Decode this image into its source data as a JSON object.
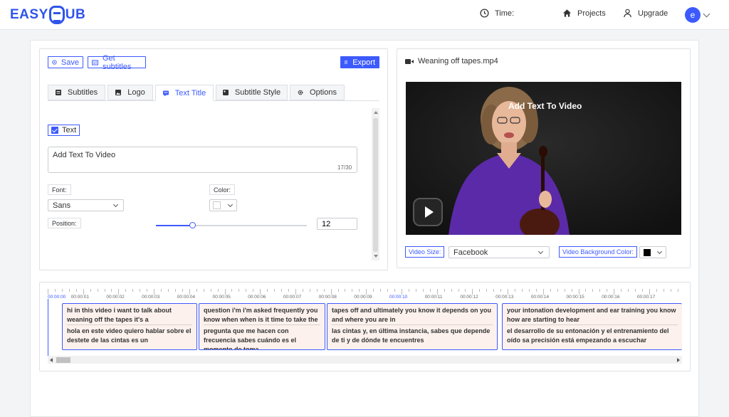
{
  "app": {
    "logo_prefix": "EASY",
    "logo_suffix": "UB"
  },
  "topnav": {
    "time_label": "Time:",
    "projects_label": "Projects",
    "upgrade_label": "Upgrade",
    "avatar_initial": "e"
  },
  "toolbar": {
    "save_label": "Save",
    "get_subtitles_label": "Get subtitles",
    "export_label": "Export"
  },
  "tabs": [
    {
      "label": "Subtitles",
      "icon": "subtitles-icon"
    },
    {
      "label": "Logo",
      "icon": "image-icon"
    },
    {
      "label": "Text Title",
      "icon": "text-title-icon"
    },
    {
      "label": "Subtitle Style",
      "icon": "style-icon"
    },
    {
      "label": "Options",
      "icon": "gear-icon"
    }
  ],
  "active_tab": "Text Title",
  "text_panel": {
    "checkbox_label": "Text",
    "checked": true,
    "text_value": "Add Text To Video",
    "char_counter": "17/30",
    "font_label": "Font:",
    "font_value": "Sans",
    "color_label": "Color:",
    "color_value": "#ffffff",
    "position_label": "Position:",
    "position_fraction": 0.24,
    "size_value": "12"
  },
  "video": {
    "file_name": "Weaning off tapes.mp4",
    "overlay_text": "Add Text To Video",
    "video_size_label": "Video Size:",
    "video_size_value": "Facebook",
    "bg_color_label": "Video Background Color:",
    "bg_color_value": "#000000"
  },
  "timeline": {
    "ticks": [
      "00:00:00",
      "00:00:01",
      "00:00:02",
      "00:00:03",
      "00:00:04",
      "00:00:05",
      "00:00:06",
      "00:00:07",
      "00:00:08",
      "00:00:09",
      "00:00:10",
      "00:00:11",
      "00:00:12",
      "00:00:13",
      "00:00:14",
      "00:00:15",
      "00:00:16",
      "00:00:17"
    ],
    "highlighted_ticks": [
      "00:00:00",
      "00:00:10"
    ],
    "subtitles": [
      {
        "en": "hi in this video i want to talk about weaning off the tapes it's a",
        "es": "hola en este video quiero hablar sobre el destete de las cintas es un"
      },
      {
        "en": "question i'm i'm asked frequently you know when when is it time to take the",
        "es": "pregunta que me hacen con frecuencia sabes cuándo es el momento de toma…"
      },
      {
        "en": "tapes off and ultimately you know it depends on you and where you are in",
        "es": "las cintas y, en última instancia, sabes que depende de ti y de dónde te encuentres"
      },
      {
        "en": "your intonation development and ear training you know how are starting to hear",
        "es": "el desarrollo de su entonación y el entrenamiento del oído sa precisión está empezando a escuchar"
      }
    ]
  },
  "colors": {
    "accent": "#3d5afe",
    "subtitle_block_bg": "#fcf1ed"
  }
}
